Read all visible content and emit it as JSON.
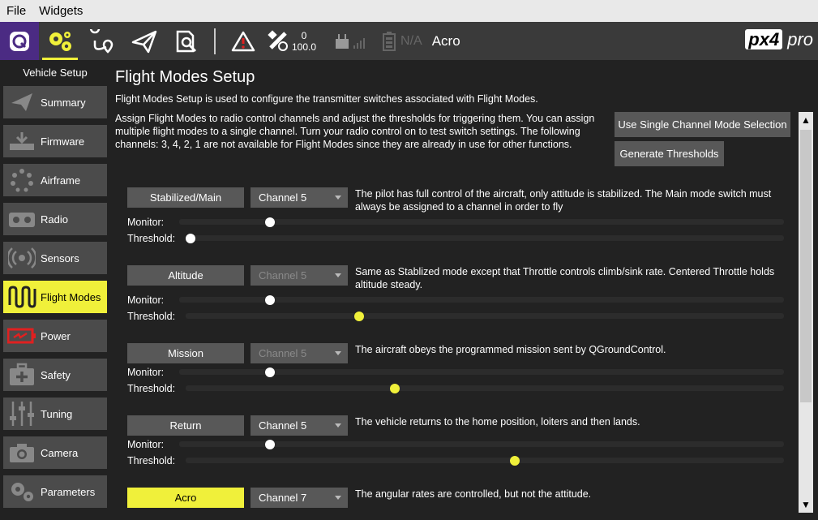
{
  "menubar": {
    "file": "File",
    "widgets": "Widgets"
  },
  "toolbar": {
    "icons": [
      "qgroundcontrol-icon",
      "vehicle-setup-gears-icon",
      "plan-route-icon",
      "fly-paper-plane-icon",
      "analyze-icon",
      "warning-icon",
      "gps-satellite-icon",
      "rc-signal-icon",
      "battery-icon"
    ],
    "gps_count": "0",
    "gps_hdop": "100.0",
    "battery": "N/A",
    "flight_mode": "Acro",
    "logo_main": "px4",
    "logo_sub": "pro",
    "accent": "#f0f03a"
  },
  "sidebar": {
    "title": "Vehicle Setup",
    "items": [
      {
        "label": "Summary",
        "icon": "paper-plane-icon"
      },
      {
        "label": "Firmware",
        "icon": "download-icon"
      },
      {
        "label": "Airframe",
        "icon": "airframe-icon"
      },
      {
        "label": "Radio",
        "icon": "radio-icon"
      },
      {
        "label": "Sensors",
        "icon": "sensors-icon"
      },
      {
        "label": "Flight Modes",
        "icon": "wave-icon"
      },
      {
        "label": "Power",
        "icon": "battery-power-icon"
      },
      {
        "label": "Safety",
        "icon": "first-aid-icon"
      },
      {
        "label": "Tuning",
        "icon": "sliders-icon"
      },
      {
        "label": "Camera",
        "icon": "camera-icon"
      },
      {
        "label": "Parameters",
        "icon": "gears-icon"
      }
    ]
  },
  "main": {
    "title": "Flight Modes Setup",
    "desc1": "Flight Modes Setup is used to configure the transmitter switches associated with Flight Modes.",
    "desc2": "Assign Flight Modes to radio control channels and adjust the thresholds for triggering them. You can assign multiple flight modes to a single channel. Turn your radio control on to test switch settings. The following channels: 3, 4, 2, 1 are not available for Flight Modes since they are already in use for other functions.",
    "single_channel_btn": "Use Single Channel Mode Selection",
    "generate_btn": "Generate Thresholds",
    "monitor_label": "Monitor:",
    "threshold_label": "Threshold:",
    "modes": [
      {
        "name": "Stabilized/Main",
        "channel": "Channel 5",
        "desc": "The pilot has full control of the aircraft, only attitude is stabilized. The Main mode switch must always be assigned to a channel in order to fly",
        "monitor": 0.15,
        "threshold": 0.0
      },
      {
        "name": "Altitude",
        "channel": "Channel 5",
        "desc": "Same as Stablized mode except that Throttle controls climb/sink rate. Centered Throttle holds altitude steady.",
        "monitor": 0.15,
        "threshold": 0.29
      },
      {
        "name": "Mission",
        "channel": "Channel 5",
        "desc": "The aircraft obeys the programmed mission sent by QGroundControl.",
        "monitor": 0.15,
        "threshold": 0.35
      },
      {
        "name": "Return",
        "channel": "Channel 5",
        "desc": "The vehicle returns to the home position, loiters and then lands.",
        "monitor": 0.15,
        "threshold": 0.55
      },
      {
        "name": "Acro",
        "channel": "Channel 7",
        "desc": "The angular rates are controlled, but not the attitude."
      }
    ]
  }
}
